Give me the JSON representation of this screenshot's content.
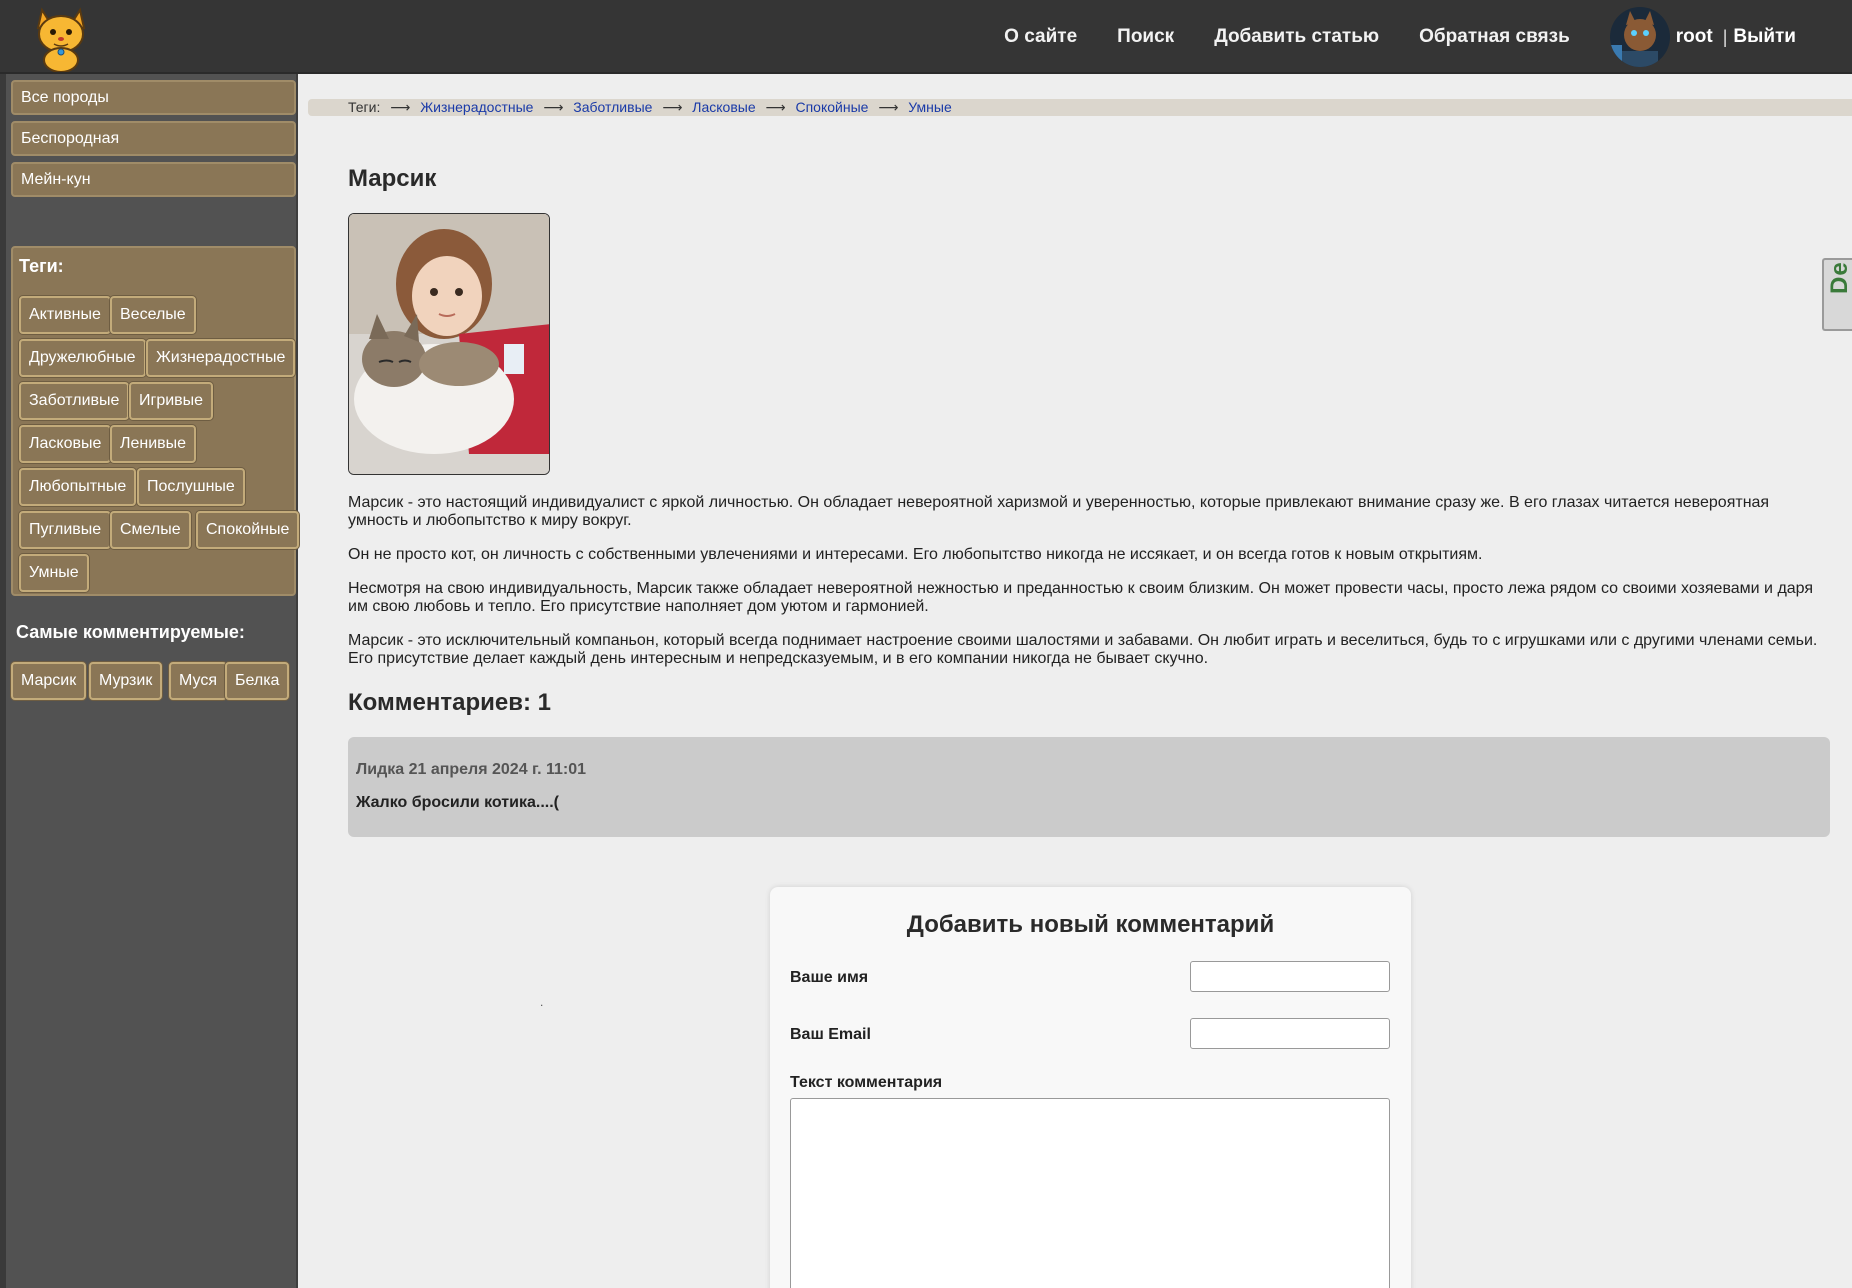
{
  "header": {
    "nav": [
      "О сайте",
      "Поиск",
      "Добавить статью",
      "Обратная связь"
    ],
    "username": "root",
    "separator": "|",
    "logout": "Выйти"
  },
  "sidebar": {
    "categories": [
      "Все породы",
      "Беспородная",
      "Мейн-кун"
    ],
    "tags_title": "Теги:",
    "tags": [
      "Активные",
      "Веселые",
      "Дружелюбные",
      "Жизнерадостные",
      "Заботливые",
      "Игривые",
      "Ласковые",
      "Ленивые",
      "Любопытные",
      "Послушные",
      "Пугливые",
      "Смелые",
      "Спокойные",
      "Умные"
    ],
    "popular_title": "Самые комментируемые:",
    "popular": [
      "Марсик",
      "Мурзик",
      "Муся",
      "Белка"
    ]
  },
  "breadcrumb": {
    "label": "Теги:",
    "arrow": "⟶",
    "tags": [
      "Жизнерадостные",
      "Заботливые",
      "Ласковые",
      "Спокойные",
      "Умные"
    ]
  },
  "article": {
    "title": "Марсик",
    "paragraphs": [
      "Марсик - это настоящий индивидуалист с яркой личностью. Он обладает невероятной харизмой и уверенностью, которые привлекают внимание сразу же. В его глазах читается невероятная умность и любопытство к миру вокруг.",
      "Он не просто кот, он личность с собственными увлечениями и интересами. Его любопытство никогда не иссякает, и он всегда готов к новым открытиям.",
      "Несмотря на свою индивидуальность, Марсик также обладает невероятной нежностью и преданностью к своим близким. Он может провести часы, просто лежа рядом со своими хозяевами и даря им свою любовь и тепло. Его присутствие наполняет дом уютом и гармонией.",
      "Марсик - это исключительный компаньон, который всегда поднимает настроение своими шалостями и забавами. Он любит играть и веселиться, будь то с игрушками или с другими членами семьи. Его присутствие делает каждый день интересным и непредсказуемым, и в его компании никогда не бывает скучно."
    ]
  },
  "comments": {
    "title": "Комментариев: 1",
    "items": [
      {
        "meta": "Лидка 21 апреля 2024 г. 11:01",
        "text": "Жалко бросили котика....("
      }
    ]
  },
  "dot": ".",
  "form": {
    "title": "Добавить новый комментарий",
    "name_label": "Ваше имя",
    "email_label": "Ваш Email",
    "text_label": "Текст комментария",
    "name_value": "",
    "email_value": "",
    "text_value": ""
  },
  "extension": {
    "label": "DeDT"
  },
  "colors": {
    "header_bg": "#353535",
    "sidebar_bg": "#525252",
    "tag_bg": "#8a7656",
    "link": "#1a3aa8",
    "comment_bg": "#cbcbcb"
  }
}
